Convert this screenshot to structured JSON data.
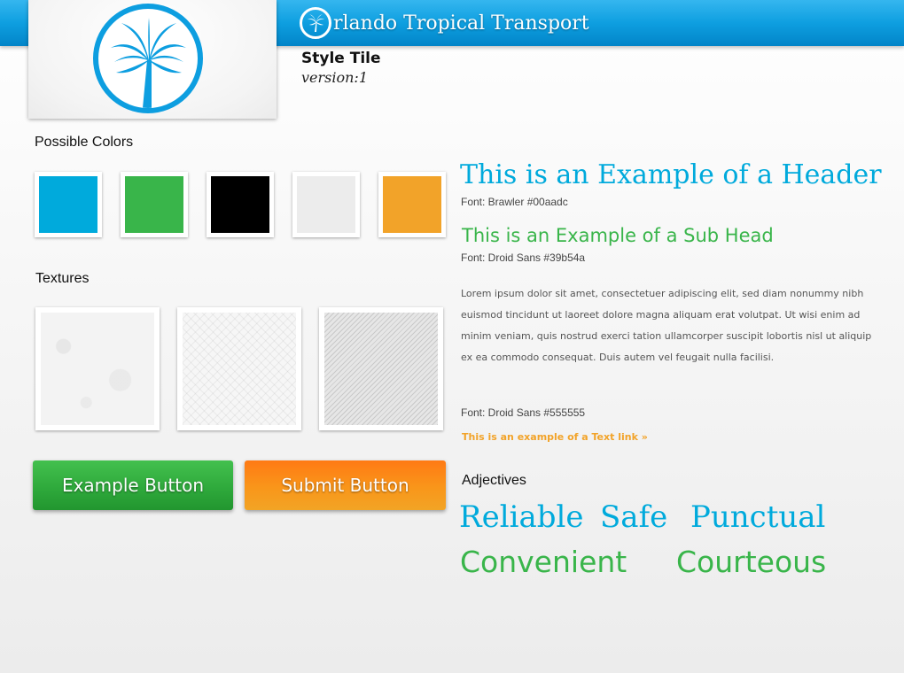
{
  "header": {
    "brand_first_letter_icon": "palm-circle-icon",
    "brand_text": "rlando Tropical Transport"
  },
  "title": {
    "style_tile": "Style Tile",
    "version": "version:1"
  },
  "colors_section": {
    "label": "Possible Colors",
    "swatches": [
      "#00aadc",
      "#39b54a",
      "#000000",
      "#ececec",
      "#f2a329"
    ]
  },
  "textures_section": {
    "label": "Textures"
  },
  "buttons": {
    "example": "Example Button",
    "submit": "Submit Button"
  },
  "typography": {
    "header_example": "This is an Example of a Header",
    "header_font": "Font: Brawler #00aadc",
    "subhead_example": "This is an Example of a Sub Head",
    "subhead_font": "Font: Droid Sans #39b54a",
    "body": "Lorem ipsum dolor sit amet, consectetuer adipiscing elit, sed diam nonummy nibh euismod tincidunt ut laoreet dolore magna aliquam erat volutpat. Ut wisi enim ad minim veniam, quis nostrud exerci tation ullamcorper suscipit lobortis nisl ut aliquip ex ea commodo consequat. Duis autem vel feugait nulla facilisi.",
    "body_font": "Font: Droid Sans #555555",
    "text_link": "This is an example of a Text link »"
  },
  "adjectives": {
    "label": "Adjectives",
    "words": [
      "Reliable",
      "Safe",
      "Punctual",
      "Convenient",
      "Courteous"
    ]
  }
}
